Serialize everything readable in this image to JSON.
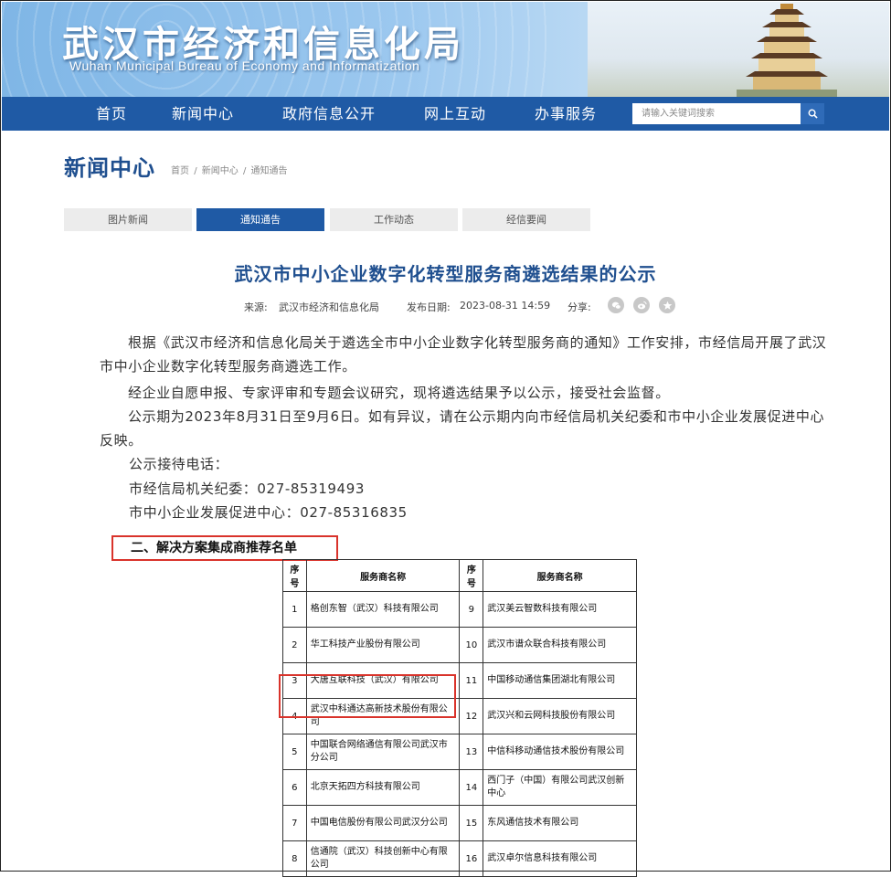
{
  "site": {
    "title": "武汉市经济和信息化局",
    "subtitle": "Wuhan Municipal Bureau of Economy and Informatization"
  },
  "nav": {
    "items": [
      "首页",
      "新闻中心",
      "政府信息公开",
      "网上互动",
      "办事服务"
    ],
    "search_placeholder": "请输入关键词搜索"
  },
  "section": {
    "title": "新闻中心",
    "breadcrumb": [
      "首页",
      "新闻中心",
      "通知通告"
    ],
    "separator": "/"
  },
  "tabs": [
    {
      "label": "图片新闻",
      "active": false
    },
    {
      "label": "通知通告",
      "active": true
    },
    {
      "label": "工作动态",
      "active": false
    },
    {
      "label": "经信要闻",
      "active": false
    }
  ],
  "article": {
    "title": "武汉市中小企业数字化转型服务商遴选结果的公示",
    "source_label": "来源:",
    "source": "武汉市经济和信息化局",
    "date_label": "发布日期:",
    "date": "2023-08-31 14:59",
    "share_label": "分享:",
    "share_icons": [
      "wechat-icon",
      "weibo-icon",
      "favorite-icon"
    ],
    "paragraphs": [
      "根据《武汉市经济和信息化局关于遴选全市中小企业数字化转型服务商的通知》工作安排，市经信局开展了武汉市中小企业数字化转型服务商遴选工作。",
      "经企业自愿申报、专家评审和专题会议研究，现将遴选结果予以公示，接受社会监督。",
      "公示期为2023年8月31日至9月6日。如有异议，请在公示期内向市经信局机关纪委和市中小企业发展促进中心反映。"
    ],
    "contacts": [
      "公示接待电话：",
      "市经信局机关纪委：027-85319493",
      "市中小企业发展促进中心：027-85316835"
    ]
  },
  "list_heading": "二、解决方案集成商推荐名单",
  "table": {
    "headers": [
      "序号",
      "服务商名称",
      "序号",
      "服务商名称"
    ],
    "rows": [
      [
        "1",
        "格创东智（武汉）科技有限公司",
        "9",
        "武汉美云智数科技有限公司"
      ],
      [
        "2",
        "华工科技产业股份有限公司",
        "10",
        "武汉市谱众联合科技有限公司"
      ],
      [
        "3",
        "大唐互联科技（武汉）有限公司",
        "11",
        "中国移动通信集团湖北有限公司"
      ],
      [
        "4",
        "武汉中科通达高新技术股份有限公司",
        "12",
        "武汉兴和云网科技股份有限公司"
      ],
      [
        "5",
        "中国联合网络通信有限公司武汉市分公司",
        "13",
        "中信科移动通信技术股份有限公司"
      ],
      [
        "6",
        "北京天拓四方科技有限公司",
        "14",
        "西门子（中国）有限公司武汉创新中心"
      ],
      [
        "7",
        "中国电信股份有限公司武汉分公司",
        "15",
        "东风通信技术有限公司"
      ],
      [
        "8",
        "信通院（武汉）科技创新中心有限公司",
        "16",
        "武汉卓尔信息科技有限公司"
      ]
    ]
  },
  "colors": {
    "nav": "#1f5aa5",
    "title": "#1f4f8f",
    "highlight": "#d9332b"
  }
}
